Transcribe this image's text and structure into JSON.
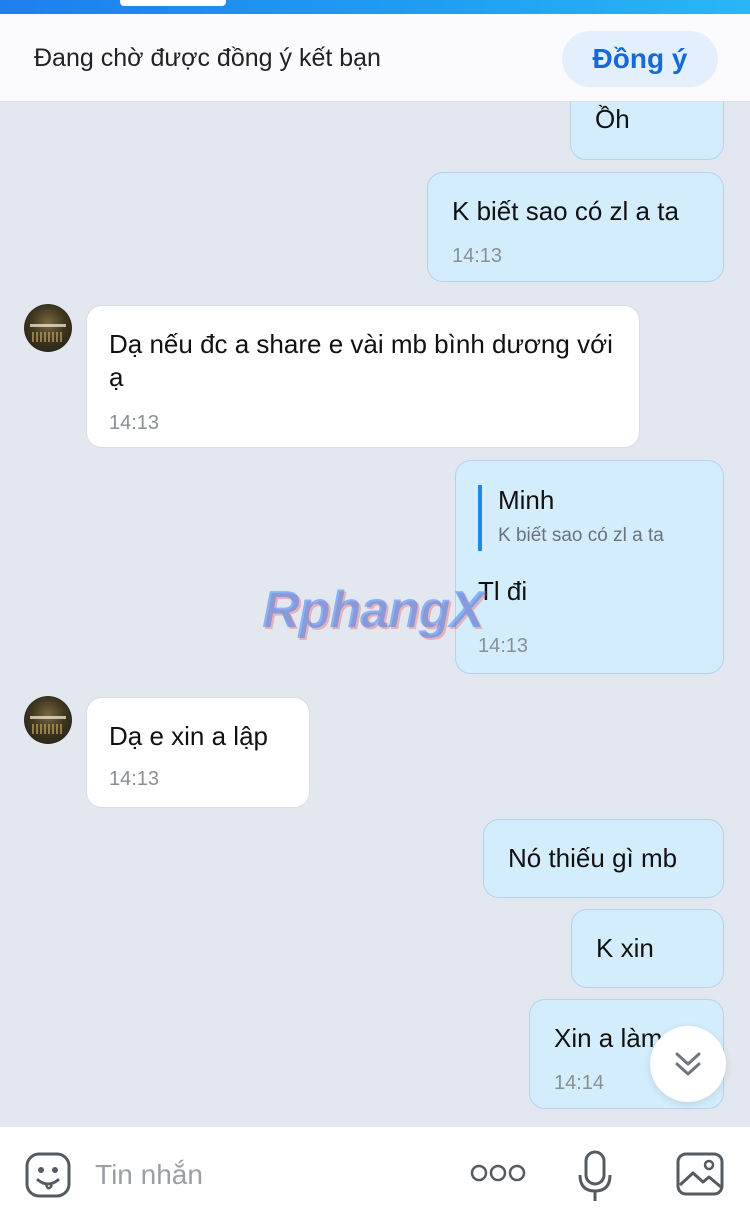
{
  "friend_request": {
    "status_text": "Đang chờ được đồng ý kết bạn",
    "accept_label": "Đồng ý"
  },
  "messages": [
    {
      "direction": "out",
      "text": "Ồh",
      "time": ""
    },
    {
      "direction": "out",
      "text": "K biết sao có zl a ta",
      "time": "14:13"
    },
    {
      "direction": "in",
      "text": "Dạ nếu đc a share e vài mb bình dương với ạ",
      "time": "14:13"
    },
    {
      "direction": "out",
      "quote": {
        "name": "Minh",
        "text": "K biết sao có zl a ta"
      },
      "text": "Tl đi",
      "time": "14:13"
    },
    {
      "direction": "in",
      "text": "Dạ e xin a lập",
      "time": "14:13"
    },
    {
      "direction": "out",
      "text": "Nó thiếu gì mb",
      "time": ""
    },
    {
      "direction": "out",
      "text": "K xin",
      "time": ""
    },
    {
      "direction": "out",
      "text": "Xin a làm",
      "time": "14:14"
    }
  ],
  "watermark": "RphangX",
  "composer": {
    "placeholder": "Tin nhắn",
    "icons": [
      "emoji-icon",
      "more-icon",
      "microphone-icon",
      "image-icon"
    ]
  },
  "colors": {
    "accent": "#1569d8",
    "outgoing_bubble": "#d4edfd",
    "incoming_bubble": "#ffffff",
    "chat_background": "#e3e7f0"
  }
}
